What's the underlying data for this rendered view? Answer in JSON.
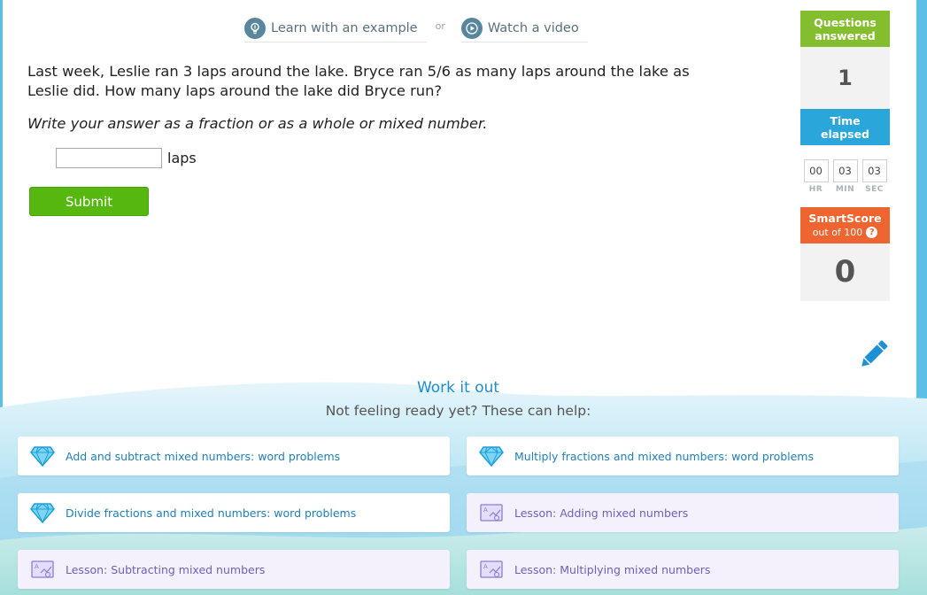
{
  "help": {
    "example_label": "Learn with an example",
    "or_label": "or",
    "video_label": "Watch a video"
  },
  "question": {
    "text": "Last week, Leslie ran 3 laps around the lake. Bryce ran 5/6 as many laps around the lake as Leslie did. How many laps around the lake did Bryce run?",
    "instruction": "Write your answer as a fraction or as a whole or mixed number.",
    "answer_value": "",
    "unit": "laps",
    "submit_label": "Submit"
  },
  "stats": {
    "questions_answered_label_1": "Questions",
    "questions_answered_label_2": "answered",
    "questions_answered": "1",
    "time_label_1": "Time",
    "time_label_2": "elapsed",
    "hours": "00",
    "minutes": "03",
    "seconds": "03",
    "hr_label": "HR",
    "min_label": "MIN",
    "sec_label": "SEC",
    "smartscore_label": "SmartScore",
    "smartscore_sub": "out of 100",
    "smartscore_help": "?",
    "smartscore": "0"
  },
  "work_it_out": {
    "title": "Work it out",
    "subtitle": "Not feeling ready yet? These can help:",
    "cards": [
      {
        "label": "Add and subtract mixed numbers: word problems",
        "icon": "diamond-icon"
      },
      {
        "label": "Multiply fractions and mixed numbers: word problems",
        "icon": "diamond-icon"
      },
      {
        "label": "Divide fractions and mixed numbers: word problems",
        "icon": "diamond-icon"
      },
      {
        "label": "Lesson: Adding mixed numbers",
        "icon": "lesson-icon"
      },
      {
        "label": "Lesson: Subtracting mixed numbers",
        "icon": "lesson-icon"
      },
      {
        "label": "Lesson: Multiplying mixed numbers",
        "icon": "lesson-icon"
      }
    ]
  },
  "colors": {
    "submit_green": "#56b70f",
    "questions_green": "#84bd2d",
    "time_blue": "#2ba6da",
    "smartscore_orange": "#ef6531",
    "link_blue": "#1f8dcc"
  }
}
